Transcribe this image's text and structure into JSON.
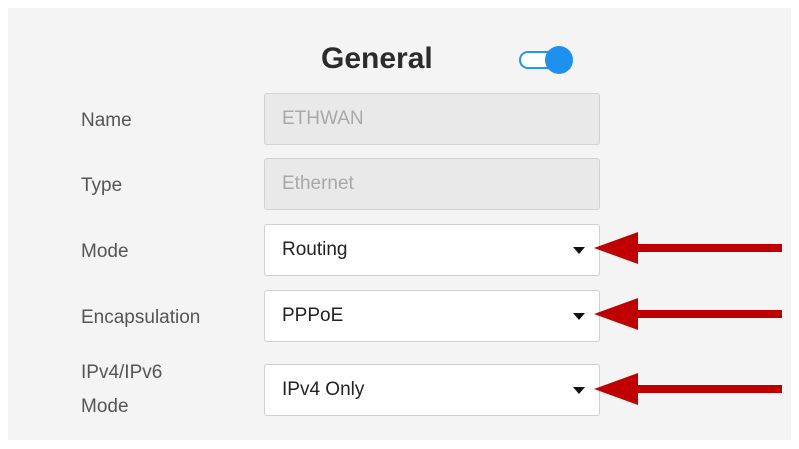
{
  "header": {
    "title": "General",
    "toggle_on": true,
    "toggle_color": "#1e90f0"
  },
  "fields": {
    "name": {
      "label": "Name",
      "value": "ETHWAN"
    },
    "type": {
      "label": "Type",
      "value": "Ethernet"
    },
    "mode": {
      "label": "Mode",
      "value": "Routing"
    },
    "encapsulation": {
      "label": "Encapsulation",
      "value": "PPPoE"
    },
    "ip_mode": {
      "label_line1": "IPv4/IPv6",
      "label_line2": "Mode",
      "value": "IPv4 Only"
    }
  },
  "annotation": {
    "arrow_color": "#c00000",
    "arrow_count": 3
  }
}
